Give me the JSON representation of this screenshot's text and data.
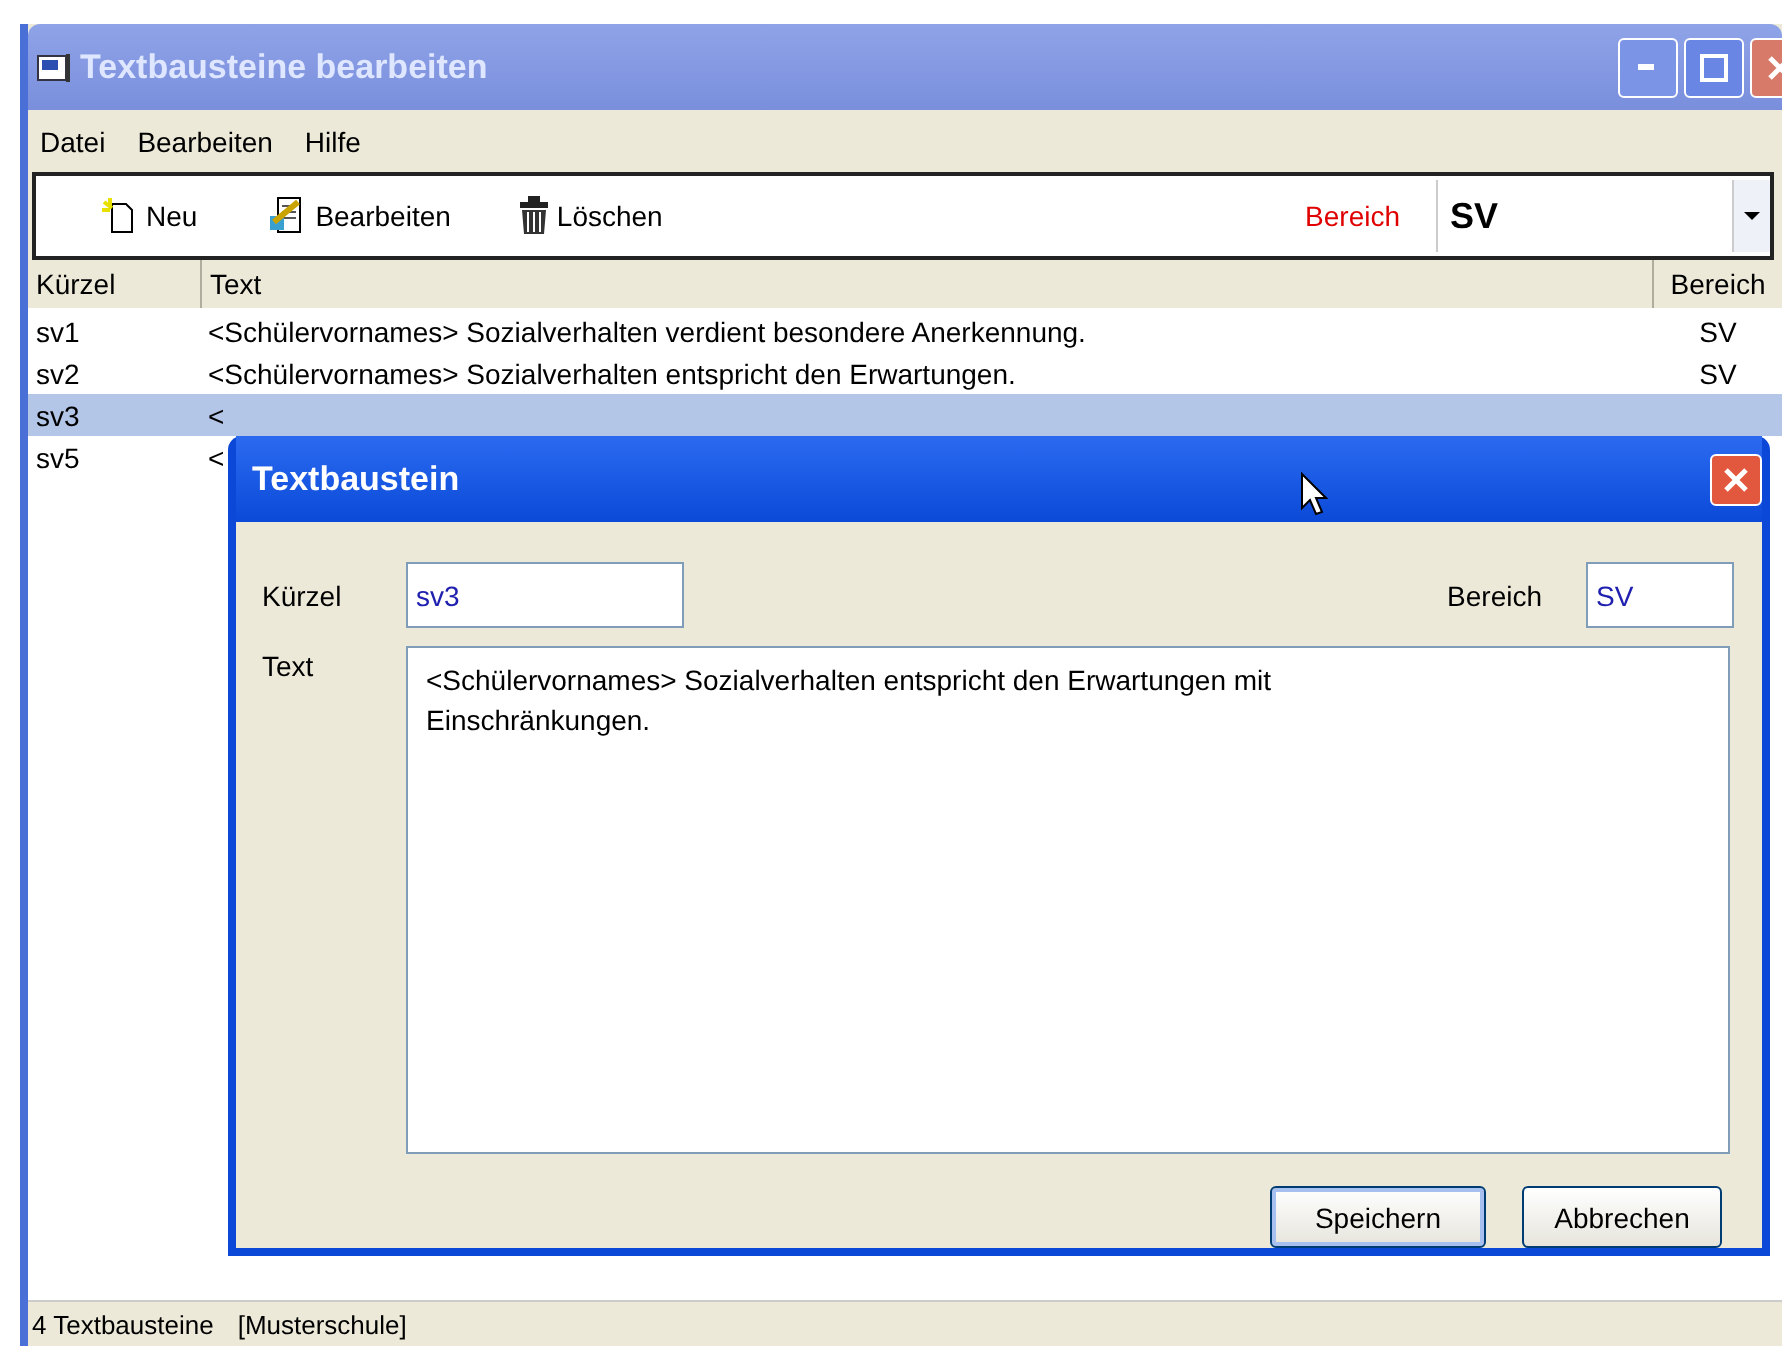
{
  "window": {
    "title": "Textbausteine bearbeiten"
  },
  "menu": [
    {
      "label": "Datei"
    },
    {
      "label": "Bearbeiten"
    },
    {
      "label": "Hilfe"
    }
  ],
  "toolbar": {
    "buttons": [
      {
        "label": "Neu",
        "kind": "new"
      },
      {
        "label": "Bearbeiten",
        "kind": "edit"
      },
      {
        "label": "Löschen",
        "kind": "delete"
      }
    ],
    "filter_label": "Bereich",
    "filter_value": "SV"
  },
  "table": {
    "columns": [
      "Kürzel",
      "Text",
      "Bereich"
    ],
    "rows": [
      {
        "cells": [
          "sv1",
          "<Schülervornames> Sozialverhalten verdient besondere Anerkennung.",
          "SV"
        ],
        "selected": false
      },
      {
        "cells": [
          "sv2",
          "<Schülervornames> Sozialverhalten entspricht den Erwartungen.",
          "SV"
        ],
        "selected": false
      },
      {
        "cells": [
          "sv3",
          "<"
        ],
        "selected": true
      },
      {
        "cells": [
          "sv5",
          "<"
        ],
        "selected": false
      }
    ]
  },
  "status_bar": {
    "count": "4 Textbausteine",
    "school": "[Musterschule]"
  },
  "dialog": {
    "title": "Textbaustein",
    "kuerzel_label": "Kürzel",
    "kuerzel_value": "sv3",
    "bereich_label": "Bereich",
    "bereich_value": "SV",
    "text_label": "Text",
    "text_value": "<Schülervornames> Sozialverhalten entspricht den Erwartungen mit Einschränkungen.",
    "buttons": [
      "Speichern",
      "Abbrechen"
    ]
  }
}
